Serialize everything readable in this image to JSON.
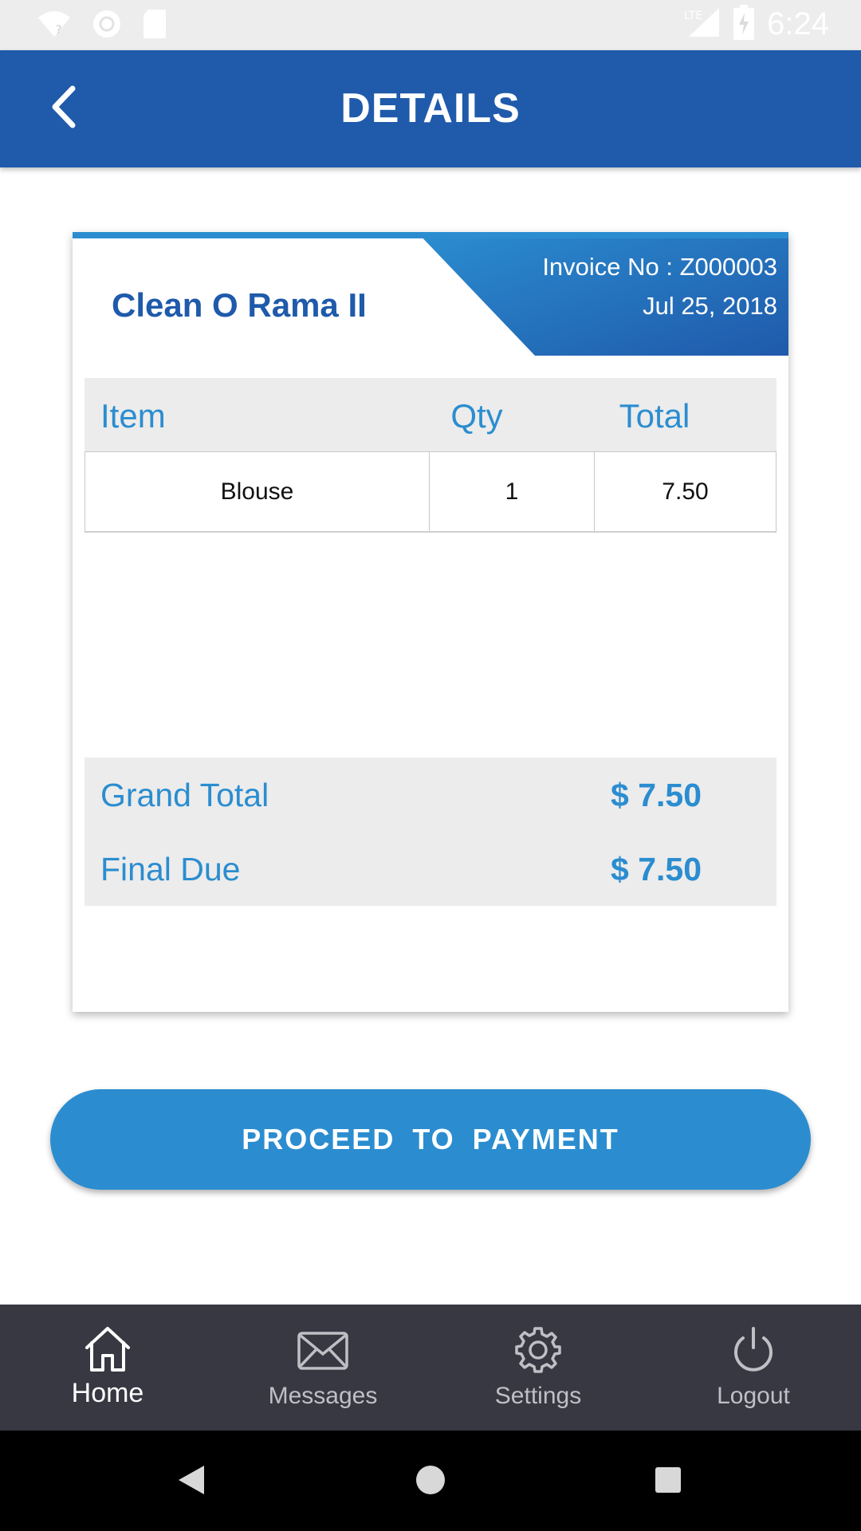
{
  "status_bar": {
    "time": "6:24",
    "network": "LTE",
    "icons": [
      "wifi-question-icon",
      "circle-icon",
      "sd-card-icon",
      "signal-icon",
      "battery-charging-icon"
    ]
  },
  "app_bar": {
    "title": "DETAILS",
    "back_icon": "chevron-left-icon"
  },
  "invoice": {
    "shop_name": "Clean O Rama II",
    "invoice_no": "Invoice No : Z000003",
    "date": "Jul 25, 2018",
    "columns": {
      "item": "Item",
      "qty": "Qty",
      "total": "Total"
    },
    "rows": [
      {
        "item": "Blouse",
        "qty": "1",
        "total": "7.50"
      }
    ],
    "grand_total_label": "Grand Total",
    "grand_total_value": "$ 7.50",
    "final_due_label": "Final Due",
    "final_due_value": "$ 7.50"
  },
  "pay_button": {
    "label": "PROCEED TO PAYMENT"
  },
  "bottom_nav": {
    "items": [
      {
        "label": "Home",
        "icon": "home-icon",
        "active": true
      },
      {
        "label": "Messages",
        "icon": "envelope-icon",
        "active": false
      },
      {
        "label": "Settings",
        "icon": "gear-icon",
        "active": false
      },
      {
        "label": "Logout",
        "icon": "power-icon",
        "active": false
      }
    ]
  },
  "system_nav": {
    "icons": [
      "back-triangle-icon",
      "home-circle-icon",
      "recents-square-icon"
    ]
  },
  "colors": {
    "app_bar": "#1f5aab",
    "accent": "#2b8dd0",
    "nav_bg": "#373842"
  }
}
